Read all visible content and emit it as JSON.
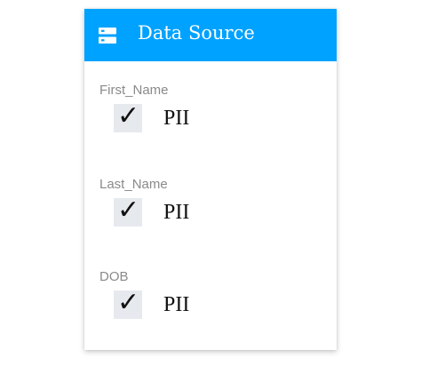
{
  "header": {
    "title": "Data Source",
    "icon": "database-icon",
    "background_color": "#00a2ff"
  },
  "fields": [
    {
      "label": "First_Name",
      "tag": "PII",
      "checked": true
    },
    {
      "label": "Last_Name",
      "tag": "PII",
      "checked": true
    },
    {
      "label": "DOB",
      "tag": "PII",
      "checked": true
    }
  ],
  "check_glyph": "✓"
}
